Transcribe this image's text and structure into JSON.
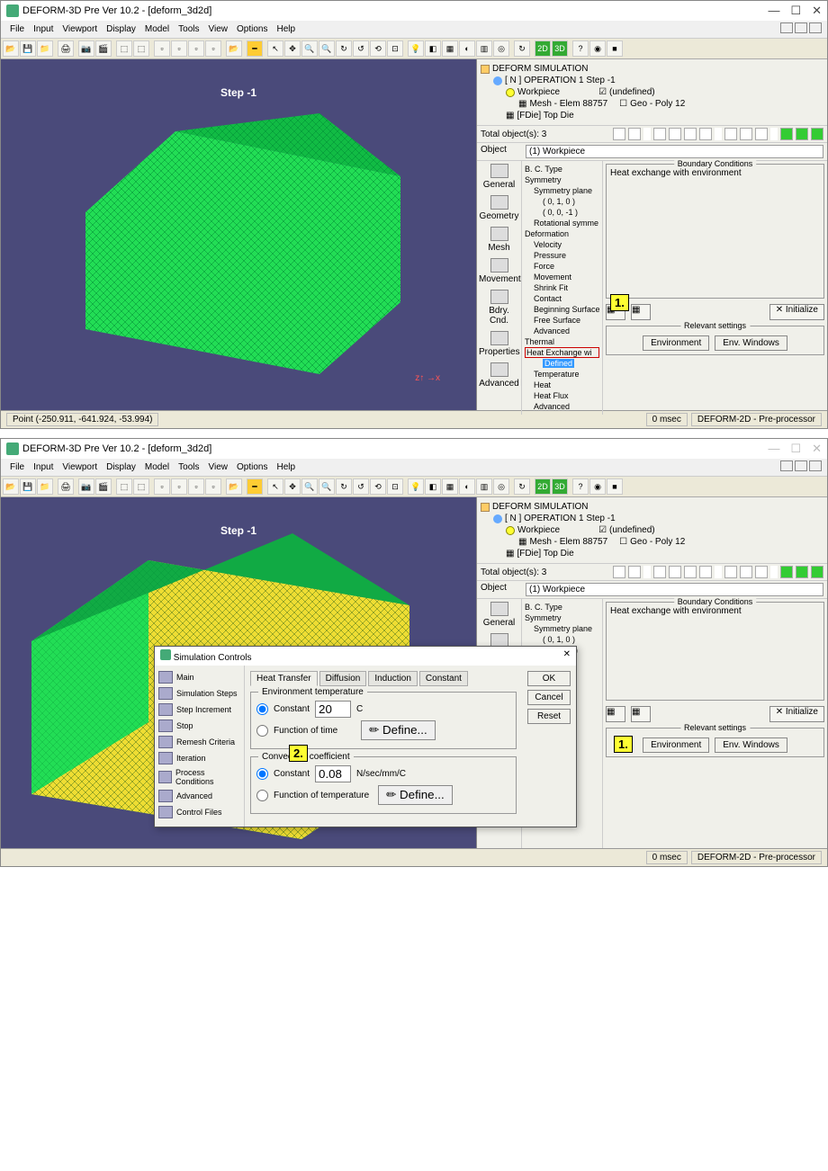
{
  "app": {
    "title": "DEFORM-3D Pre Ver 10.2 - [deform_3d2d]"
  },
  "menu": [
    "File",
    "Input",
    "Viewport",
    "Display",
    "Model",
    "Tools",
    "View",
    "Options",
    "Help"
  ],
  "viewport": {
    "step_label": "Step  -1",
    "axes": {
      "z": "z",
      "x": "x"
    }
  },
  "tree": {
    "root": "DEFORM SIMULATION",
    "op": "[ N ]  OPERATION 1  Step -1",
    "workpiece": "Workpiece",
    "mesh": "Mesh - Elem 88757",
    "topdie": "[FDie] Top Die",
    "undefined": "(undefined)",
    "geo": "Geo - Poly 12",
    "total": "Total object(s): 3"
  },
  "object_row": {
    "label": "Object",
    "value": "(1) Workpiece"
  },
  "categories": [
    "General",
    "Geometry",
    "Mesh",
    "Movement",
    "Bdry. Cnd.",
    "Properties",
    "Advanced"
  ],
  "bc_tree": {
    "type_label": "B. C. Type",
    "symmetry": "Symmetry",
    "sym_plane": "Symmetry plane",
    "plane1": "( 0, 1, 0 )",
    "plane2": "( 0, 0, -1 )",
    "rot": "Rotational symme",
    "deformation": "Deformation",
    "velocity": "Velocity",
    "pressure": "Pressure",
    "force": "Force",
    "movement": "Movement",
    "shrink": "Shrink Fit",
    "contact": "Contact",
    "beginning": "Beginning Surface",
    "free": "Free Surface",
    "advanced": "Advanced",
    "thermal": "Thermal",
    "heat_ex": "Heat Exchange wi",
    "defined": "Defined",
    "temperature": "Temperature",
    "heat": "Heat",
    "heat_flux": "Heat Flux"
  },
  "bc_panel": {
    "title": "Boundary Conditions",
    "desc": "Heat exchange with environment",
    "initialize": "Initialize",
    "rel_title": "Relevant settings",
    "env_btn": "Environment",
    "env_win_btn": "Env. Windows"
  },
  "annotations": {
    "one": "1.",
    "two": "2."
  },
  "status": {
    "point": "Point (-250.911, -641.924, -53.994)",
    "time": "0 msec",
    "mode": "DEFORM-2D  -  Pre-processor"
  },
  "dialog": {
    "title": "Simulation Controls",
    "side_items": [
      "Main",
      "Simulation Steps",
      "Step Increment",
      "Stop",
      "Remesh Criteria",
      "Iteration",
      "Process Conditions",
      "Advanced",
      "Control Files"
    ],
    "tabs": [
      "Heat Transfer",
      "Diffusion",
      "Induction",
      "Constant"
    ],
    "env_temp": {
      "title": "Environment temperature",
      "constant": "Constant",
      "value": "20",
      "unit": "C",
      "fot": "Function of time",
      "define": "Define..."
    },
    "conv": {
      "title": "Convection coefficient",
      "constant": "Constant",
      "value": "0.08",
      "unit": "N/sec/mm/C",
      "fot": "Function of temperature",
      "define": "Define..."
    },
    "buttons": {
      "ok": "OK",
      "cancel": "Cancel",
      "reset": "Reset"
    }
  }
}
